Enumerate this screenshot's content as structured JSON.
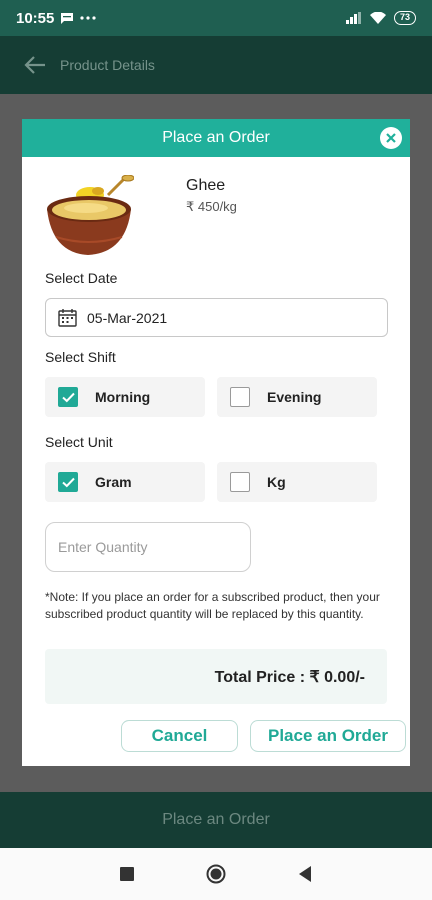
{
  "status_bar": {
    "time": "10:55",
    "battery": "73"
  },
  "app_header": {
    "title": "Product Details"
  },
  "bottom_bar": {
    "label": "Place an Order"
  },
  "dialog": {
    "title": "Place an Order",
    "product": {
      "name": "Ghee",
      "price": "₹ 450/kg"
    },
    "date": {
      "label": "Select Date",
      "value": "05-Mar-2021"
    },
    "shift": {
      "label": "Select Shift",
      "options": [
        {
          "label": "Morning",
          "checked": true
        },
        {
          "label": "Evening",
          "checked": false
        }
      ]
    },
    "unit": {
      "label": "Select Unit",
      "options": [
        {
          "label": "Gram",
          "checked": true
        },
        {
          "label": "Kg",
          "checked": false
        }
      ]
    },
    "quantity": {
      "placeholder": "Enter Quantity"
    },
    "note": "*Note: If you place an order for a subscribed product, then your subscribed product quantity will be replaced by this quantity.",
    "total": "Total Price : ₹ 0.00/-",
    "cancel_label": "Cancel",
    "submit_label": "Place an Order"
  },
  "colors": {
    "accent": "#20b09b",
    "dark": "#153d34"
  }
}
